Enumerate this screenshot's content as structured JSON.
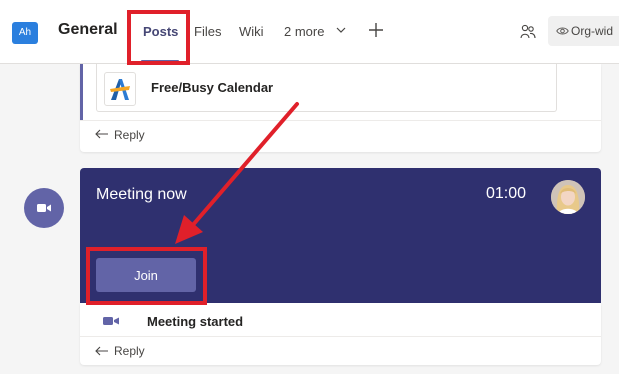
{
  "header": {
    "team_avatar": "Ah",
    "channel_name": "General",
    "tabs": [
      {
        "label": "Posts",
        "active": true
      },
      {
        "label": "Files"
      },
      {
        "label": "Wiki"
      },
      {
        "label": "2 more"
      }
    ],
    "more_icon": "chevron-down-icon",
    "add_icon": "plus-icon",
    "people_icon": "people-icon",
    "org_icon": "eye-icon",
    "org_label": "Org-wid"
  },
  "posts": [
    {
      "card": {
        "icon": "calendar-app-icon",
        "title": "Free/Busy Calendar"
      },
      "reply_label": "Reply"
    }
  ],
  "meeting": {
    "icon": "video-camera-icon",
    "title": "Meeting now",
    "timer": "01:00",
    "join_label": "Join",
    "status_text": "Meeting started",
    "reply_label": "Reply"
  },
  "colors": {
    "accent": "#6264a7",
    "meeting_card": "#2f306f",
    "annotation": "#e0202a",
    "team_avatar": "#2b7fde"
  }
}
